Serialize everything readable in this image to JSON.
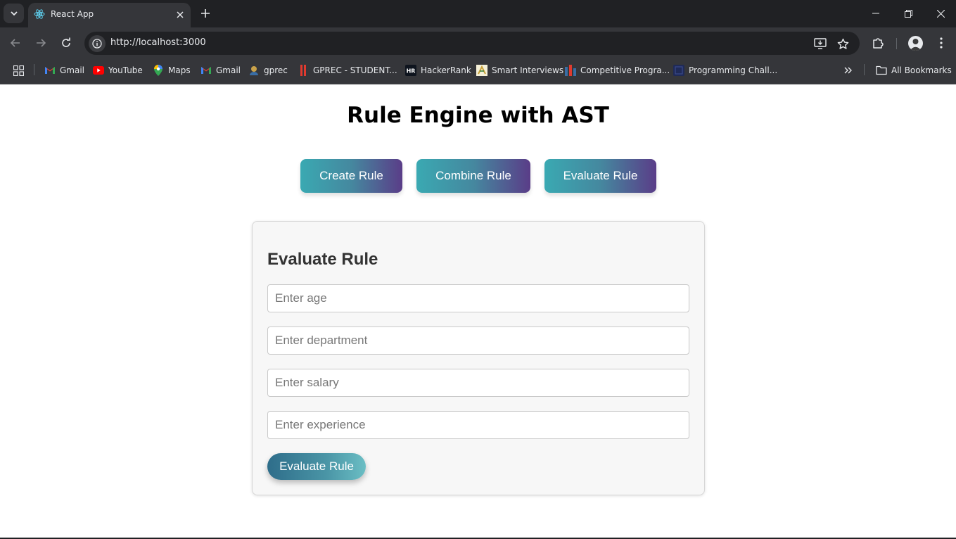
{
  "browser": {
    "tab": {
      "title": "React App",
      "favicon": "react-icon"
    },
    "url": "http://localhost:3000",
    "bookmarks": [
      {
        "label": "Gmail",
        "icon": "gmail-icon"
      },
      {
        "label": "YouTube",
        "icon": "youtube-icon"
      },
      {
        "label": "Maps",
        "icon": "maps-icon"
      },
      {
        "label": "Gmail",
        "icon": "gmail-icon"
      },
      {
        "label": "gprec",
        "icon": "gprec-icon"
      },
      {
        "label": "GPREC - STUDENT...",
        "icon": "gprec-student-icon"
      },
      {
        "label": "HackerRank",
        "icon": "hackerrank-icon"
      },
      {
        "label": "Smart Interviews",
        "icon": "smart-interviews-icon"
      },
      {
        "label": "Competitive Progra...",
        "icon": "competitive-programming-icon"
      },
      {
        "label": "Programming Chall...",
        "icon": "programming-challenges-icon"
      }
    ],
    "all_bookmarks_label": "All Bookmarks"
  },
  "app": {
    "title": "Rule Engine with AST",
    "nav": {
      "create": "Create Rule",
      "combine": "Combine Rule",
      "evaluate": "Evaluate Rule"
    },
    "form": {
      "heading": "Evaluate Rule",
      "age_placeholder": "Enter age",
      "department_placeholder": "Enter department",
      "salary_placeholder": "Enter salary",
      "experience_placeholder": "Enter experience",
      "submit_label": "Evaluate Rule"
    }
  },
  "colors": {
    "button_gradient_start": "#3aa9b2",
    "button_gradient_end": "#5a3d88",
    "submit_gradient_start": "#2e6d8a",
    "submit_gradient_end": "#6bbec4",
    "chrome_dark": "#202124",
    "chrome_toolbar": "#35363a"
  }
}
